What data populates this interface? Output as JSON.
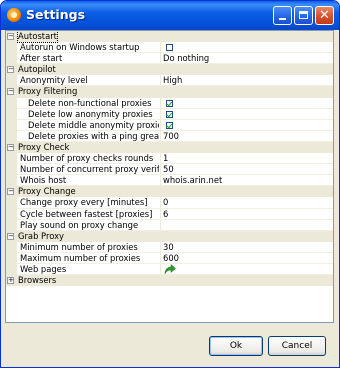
{
  "window": {
    "title": "Settings"
  },
  "grid": {
    "rows": [
      {
        "kind": "category",
        "label": "Autostart",
        "expanded": true,
        "selected": true
      },
      {
        "kind": "prop",
        "label": "Autorun on Windows startup",
        "type": "checkbox",
        "checked": false
      },
      {
        "kind": "prop",
        "label": "After start",
        "type": "text",
        "value": "Do nothing"
      },
      {
        "kind": "category",
        "label": "Autopilot",
        "expanded": true
      },
      {
        "kind": "prop",
        "label": "Anonymity level",
        "type": "text",
        "value": "High"
      },
      {
        "kind": "category",
        "label": "Proxy Filtering",
        "expanded": true
      },
      {
        "kind": "prop",
        "label": "Delete non-functional proxies",
        "type": "checkbox",
        "checked": true,
        "indent": true
      },
      {
        "kind": "prop",
        "label": "Delete low anonymity proxies",
        "type": "checkbox",
        "checked": true,
        "indent": true
      },
      {
        "kind": "prop",
        "label": "Delete middle anonymity proxies",
        "type": "checkbox",
        "checked": true,
        "indent": true
      },
      {
        "kind": "prop",
        "label": "Delete proxies with a ping great...",
        "type": "text",
        "value": "700",
        "indent": true
      },
      {
        "kind": "category",
        "label": "Proxy Check",
        "expanded": true
      },
      {
        "kind": "prop",
        "label": "Number of proxy checks rounds",
        "type": "text",
        "value": "1"
      },
      {
        "kind": "prop",
        "label": "Number of concurrent proxy verific...",
        "type": "text",
        "value": "50"
      },
      {
        "kind": "prop",
        "label": "Whois host",
        "type": "text",
        "value": "whois.arin.net"
      },
      {
        "kind": "category",
        "label": "Proxy Change",
        "expanded": true
      },
      {
        "kind": "prop",
        "label": "Change proxy every [minutes]",
        "type": "text",
        "value": "0"
      },
      {
        "kind": "prop",
        "label": "Cycle between fastest [proxies]",
        "type": "text",
        "value": "6"
      },
      {
        "kind": "prop",
        "label": "Play sound on proxy change",
        "type": "text",
        "value": ""
      },
      {
        "kind": "category",
        "label": "Grab Proxy",
        "expanded": true
      },
      {
        "kind": "prop",
        "label": "Minimum number of proxies",
        "type": "text",
        "value": "30"
      },
      {
        "kind": "prop",
        "label": "Maximum number of proxies",
        "type": "text",
        "value": "600"
      },
      {
        "kind": "prop",
        "label": "Web pages",
        "type": "icon",
        "icon": "green-arrow-icon"
      },
      {
        "kind": "category",
        "label": "Browsers",
        "expanded": false
      }
    ]
  },
  "buttons": {
    "ok": "Ok",
    "cancel": "Cancel"
  },
  "colors": {
    "titlebar": "#0550d8",
    "window": "#ece9d8",
    "checkmark": "#21a121",
    "arrow": "#2e9a2e"
  }
}
